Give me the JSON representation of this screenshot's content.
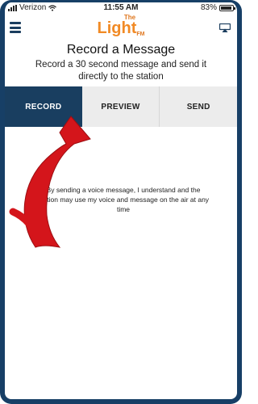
{
  "status_bar": {
    "carrier": "Verizon",
    "time": "11:55 AM",
    "battery": "83%"
  },
  "app_bar": {
    "logo_the": "The",
    "logo_light": "Light",
    "logo_fm": "FM"
  },
  "header": {
    "title": "Record a Message",
    "subtitle": "Record a 30 second message and send it directly to the station"
  },
  "tabs": [
    {
      "label": "RECORD",
      "active": true
    },
    {
      "label": "PREVIEW",
      "active": false
    },
    {
      "label": "SEND",
      "active": false
    }
  ],
  "disclaimer": "By sending a voice message, I understand and the station may use my voice and message on the air at any time",
  "colors": {
    "frame": "#173f66",
    "active_tab": "#193e60",
    "logo_orange": "#f18a25",
    "arrow_red": "#d4151b"
  }
}
